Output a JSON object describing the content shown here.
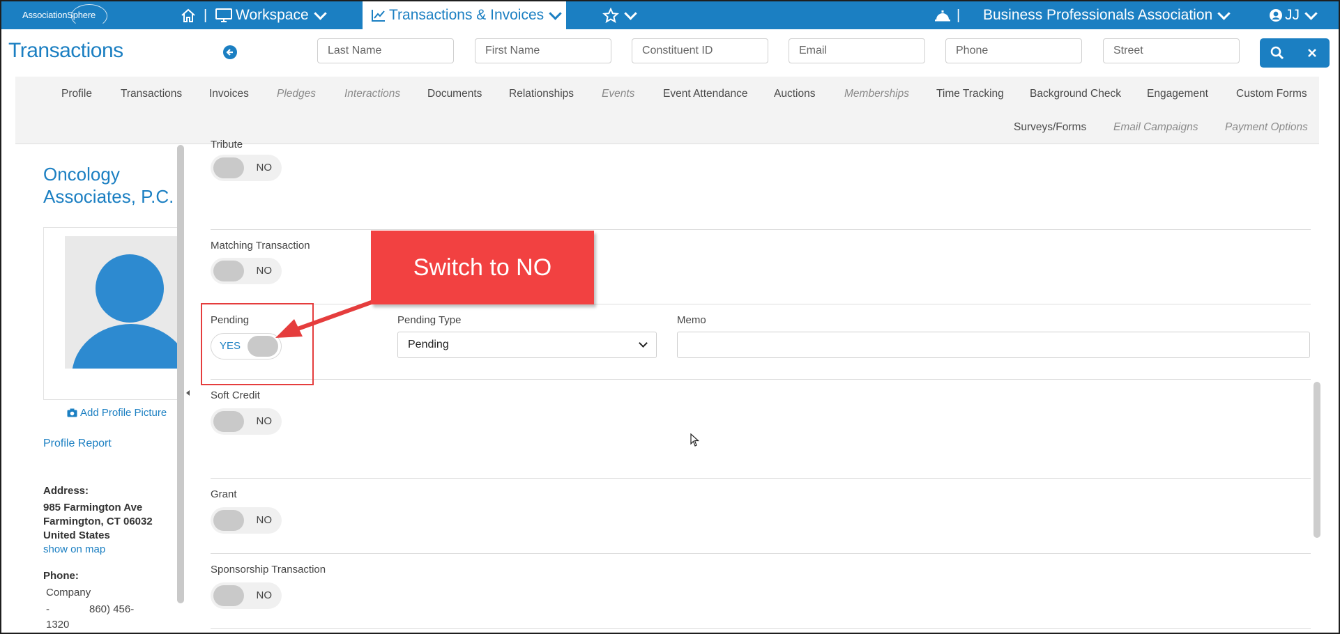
{
  "topbar": {
    "logo_text": "AssociationSphere",
    "workspace_label": "Workspace",
    "transactions_label": "Transactions & Invoices",
    "org_label": "Business Professionals Association",
    "user_initials": "JJ",
    "colors": {
      "brand": "#1b7fc2",
      "accent_red": "#f24141"
    }
  },
  "header": {
    "title": "Transactions"
  },
  "search": {
    "last_name": "Last Name",
    "first_name": "First Name",
    "constituent_id": "Constituent ID",
    "email": "Email",
    "phone": "Phone",
    "street": "Street"
  },
  "tabs": {
    "row1": [
      "Profile",
      "Transactions",
      "Invoices",
      "Pledges",
      "Interactions",
      "Documents",
      "Relationships",
      "Events",
      "Event Attendance",
      "Auctions",
      "Memberships",
      "Time Tracking",
      "Background Check",
      "Engagement",
      "Custom Forms"
    ],
    "row2": [
      "Surveys/Forms",
      "Email Campaigns",
      "Payment Options"
    ],
    "disabled": [
      "Pledges",
      "Interactions",
      "Events",
      "Memberships",
      "Email Campaigns",
      "Payment Options"
    ]
  },
  "profile": {
    "org_name": "Oncology Associates, P.C.",
    "add_picture": "Add Profile Picture",
    "profile_report": "Profile Report",
    "address_label": "Address:",
    "address_line1": "985 Farmington Ave",
    "address_line2": "Farmington, CT 06032",
    "address_line3": "United States",
    "show_map": "show on map",
    "phone_label": "Phone:",
    "phone_type": "Company",
    "phone_dash": "-",
    "phone_number_part1": "860) 456-",
    "phone_number_part2": "1320"
  },
  "form": {
    "tribute_partial_label": "Tribute",
    "tribute_value": "NO",
    "matching_label": "Matching Transaction",
    "matching_value": "NO",
    "pending_label": "Pending",
    "pending_value": "YES",
    "pending_type_label": "Pending Type",
    "pending_type_value": "Pending",
    "memo_label": "Memo",
    "soft_credit_label": "Soft Credit",
    "soft_credit_value": "NO",
    "grant_label": "Grant",
    "grant_value": "NO",
    "sponsorship_label": "Sponsorship Transaction",
    "sponsorship_value": "NO"
  },
  "annotation": {
    "callout_text": "Switch to NO"
  }
}
